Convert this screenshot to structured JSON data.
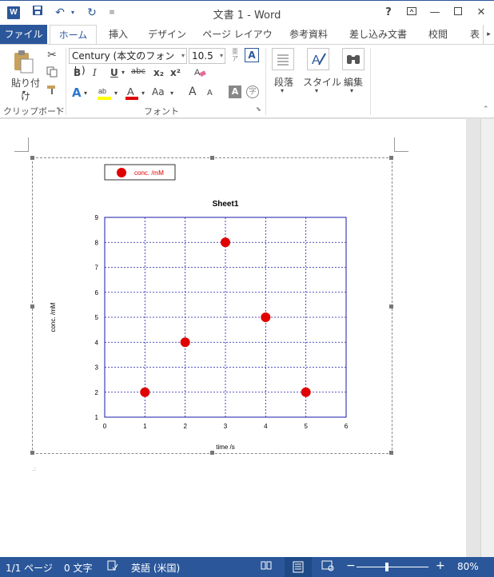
{
  "window": {
    "title": "文書 1 - Word",
    "app_icon": "word-icon",
    "help": "?",
    "controls": [
      "ribbon-display-icon",
      "minimize-icon",
      "maximize-icon",
      "close-icon"
    ]
  },
  "quick_access": [
    "save-icon",
    "undo-icon",
    "redo-icon",
    "customize-icon"
  ],
  "tabs": [
    {
      "label": "ファイル"
    },
    {
      "label": "ホーム"
    },
    {
      "label": "挿入"
    },
    {
      "label": "デザイン"
    },
    {
      "label": "ページ レイアウト"
    },
    {
      "label": "参考資料"
    },
    {
      "label": "差し込み文書"
    },
    {
      "label": "校閲"
    },
    {
      "label": "表"
    }
  ],
  "ribbon": {
    "clipboard": {
      "paste_label": "貼り付け",
      "group_label": "クリップボード"
    },
    "font": {
      "font_name": "Century (本文のフォント)",
      "font_size": "10.5",
      "group_label": "フォント",
      "bold": "B",
      "italic": "I",
      "underline": "U",
      "strike": "abc",
      "subscript": "x₂",
      "superscript": "x²",
      "grow": "A",
      "shrink": "A",
      "case": "Aa"
    },
    "paragraph": {
      "label": "段落"
    },
    "styles": {
      "label": "スタイル"
    },
    "editing": {
      "label": "編集"
    }
  },
  "statusbar": {
    "page": "1/1 ページ",
    "words": "0 文字",
    "language": "英語 (米国)",
    "zoom": "80%",
    "zoom_minus": "−",
    "zoom_plus": "+"
  },
  "chart_data": {
    "type": "scatter",
    "title": "Sheet1",
    "xlabel": "time /s",
    "ylabel": "conc. /mM",
    "xlim": [
      0,
      6
    ],
    "ylim": [
      1,
      9
    ],
    "xticks": [
      0,
      1,
      2,
      3,
      4,
      5,
      6
    ],
    "yticks": [
      1,
      2,
      3,
      4,
      5,
      6,
      7,
      8,
      9
    ],
    "grid": true,
    "legend_position": "top-left",
    "series": [
      {
        "name": "conc. /mM",
        "color": "#e00000",
        "x": [
          1,
          2,
          3,
          4,
          5
        ],
        "y": [
          2,
          4,
          8,
          5,
          2
        ]
      }
    ]
  }
}
